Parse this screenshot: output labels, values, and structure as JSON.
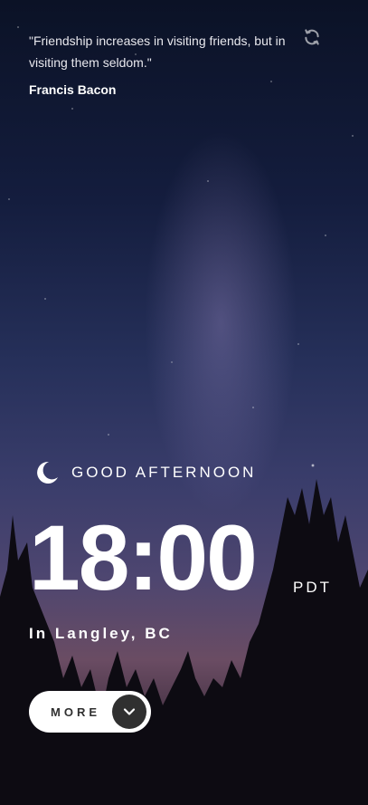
{
  "quote": {
    "text": "\"Friendship increases in visiting friends, but in visiting them seldom.\"",
    "author": "Francis Bacon"
  },
  "refresh": {
    "icon": "refresh-icon"
  },
  "greeting": {
    "icon": "moon-icon",
    "text": "GOOD AFTERNOON"
  },
  "clock": {
    "time": "18:00",
    "timezone": "PDT",
    "location": "In Langley, BC"
  },
  "more_button": {
    "label": "MORE",
    "icon": "chevron-down-icon"
  },
  "colors": {
    "text": "#ffffff",
    "button_bg": "#ffffff",
    "button_text": "#303030",
    "button_circle": "#303030"
  }
}
